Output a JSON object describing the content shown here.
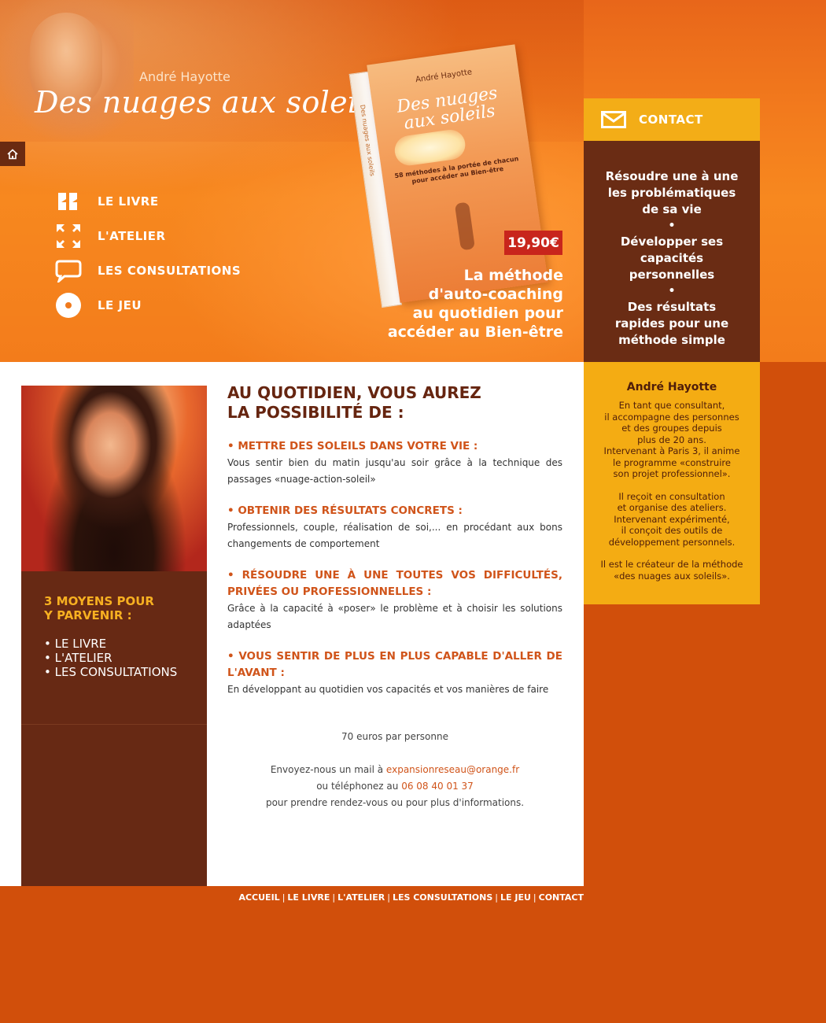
{
  "header": {
    "author": "André Hayotte",
    "site_title": "Des nuages aux soleils",
    "price": "19,90€",
    "tagline": [
      "La méthode",
      "d'auto-coaching",
      "au quotidien pour",
      "accéder au Bien-être"
    ]
  },
  "book": {
    "author": "André Hayotte",
    "title_line1": "Des nuages",
    "title_line2": "aux soleils",
    "subtitle": "58 méthodes à la portée de chacun pour accéder au Bien-être",
    "spine": "Des nuages aux soleils"
  },
  "nav": {
    "items": [
      {
        "label": "LE LIVRE",
        "icon": "quote-icon"
      },
      {
        "label": "L'ATELIER",
        "icon": "expand-arrows-icon"
      },
      {
        "label": "LES CONSULTATIONS",
        "icon": "speech-bubble-icon"
      },
      {
        "label": "LE JEU",
        "icon": "disc-icon"
      }
    ]
  },
  "contact": {
    "label": "CONTACT",
    "icon": "envelope-icon"
  },
  "benefits": [
    "Résoudre une à une les problématiques de sa vie",
    "Développer ses capacités personnelles",
    "Des résultats rapides pour une méthode simple"
  ],
  "author_panel": {
    "name": "André Hayotte",
    "p1": "En tant que consultant,\nil accompagne des personnes\net des groupes depuis\nplus de 20 ans.\nIntervenant à Paris 3, il anime\nle programme «construire\nson projet professionnel».",
    "p2": "Il reçoit en consultation\net organise des ateliers.\nIntervenant expérimenté,\nil conçoit des outils de\ndéveloppement personnels.",
    "p3": "Il est le créateur de la méthode\n«des nuages aux soleils»."
  },
  "left_col": {
    "heading_line1": "3 MOYENS POUR",
    "heading_line2": "Y PARVENIR :",
    "items": [
      "• LE LIVRE",
      "• L'ATELIER",
      "• LES CONSULTATIONS"
    ]
  },
  "main": {
    "heading_line1": "AU QUOTIDIEN, VOUS AUREZ",
    "heading_line2": "LA POSSIBILITÉ DE :",
    "sections": [
      {
        "title": "• METTRE DES SOLEILS DANS VOTRE VIE :",
        "body": "Vous sentir bien du matin jusqu'au soir grâce à la technique des passages «nuage-action-soleil»"
      },
      {
        "title": "• OBTENIR DES RÉSULTATS CONCRETS :",
        "body": "Professionnels, couple, réalisation de soi,... en procédant aux bons changements de comportement"
      },
      {
        "title": "• RÉSOUDRE UNE À UNE TOUTES VOS DIFFICULTÉS, PRIVÉES OU PROFESSIONNELLES :",
        "body": "Grâce à la capacité à «poser» le problème et à choisir les solutions adaptées"
      },
      {
        "title": "• VOUS SENTIR DE PLUS EN PLUS CAPABLE D'ALLER DE L'AVANT :",
        "body": "En développant au quotidien  vos capacités et vos manières de faire"
      }
    ],
    "price_text": "70 euros par personne",
    "mail_prefix": "Envoyez-nous un mail à ",
    "email": "expansionreseau@orange.fr",
    "phone_prefix": "ou téléphonez au ",
    "phone": "06 08 40 01 37",
    "closing": "pour prendre rendez-vous ou pour plus d'informations."
  },
  "footer": {
    "links": [
      "ACCUEIL",
      "LE LIVRE",
      "L'ATELIER",
      "LES CONSULTATIONS",
      "LE JEU",
      "CONTACT"
    ]
  },
  "colors": {
    "background": "#d14f0b",
    "dark_brown": "#6a2c14",
    "gold": "#f3ad17",
    "accent_orange": "#d0541a",
    "price_red": "#c8251c"
  }
}
